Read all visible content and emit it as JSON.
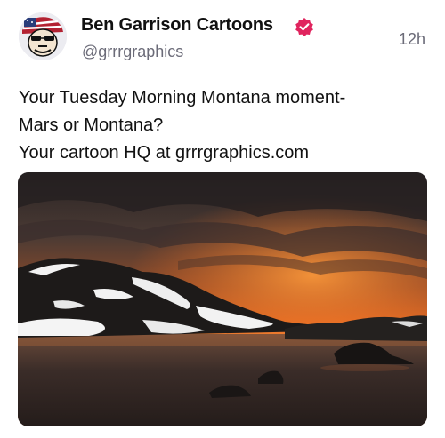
{
  "author": {
    "name": "Ben Garrison Cartoons",
    "handle": "@grrrgraphics",
    "verified": true,
    "avatar_icon": "cartoon-avatar-icon"
  },
  "timestamp": "12h",
  "post": {
    "lines": [
      "Your Tuesday Morning Montana moment-",
      "Mars or Montana?",
      "Your cartoon HQ at grrrgraphics.com"
    ]
  },
  "media": {
    "type": "photo",
    "colors": {
      "sky_top": "#2b2626",
      "sky_glow": "#e8752a",
      "water": "#3a2a22",
      "snow": "#f2f2f2",
      "rock": "#1c1a19"
    }
  },
  "colors": {
    "verified_badge": "#e0245e",
    "secondary_text": "#6b6b78"
  }
}
